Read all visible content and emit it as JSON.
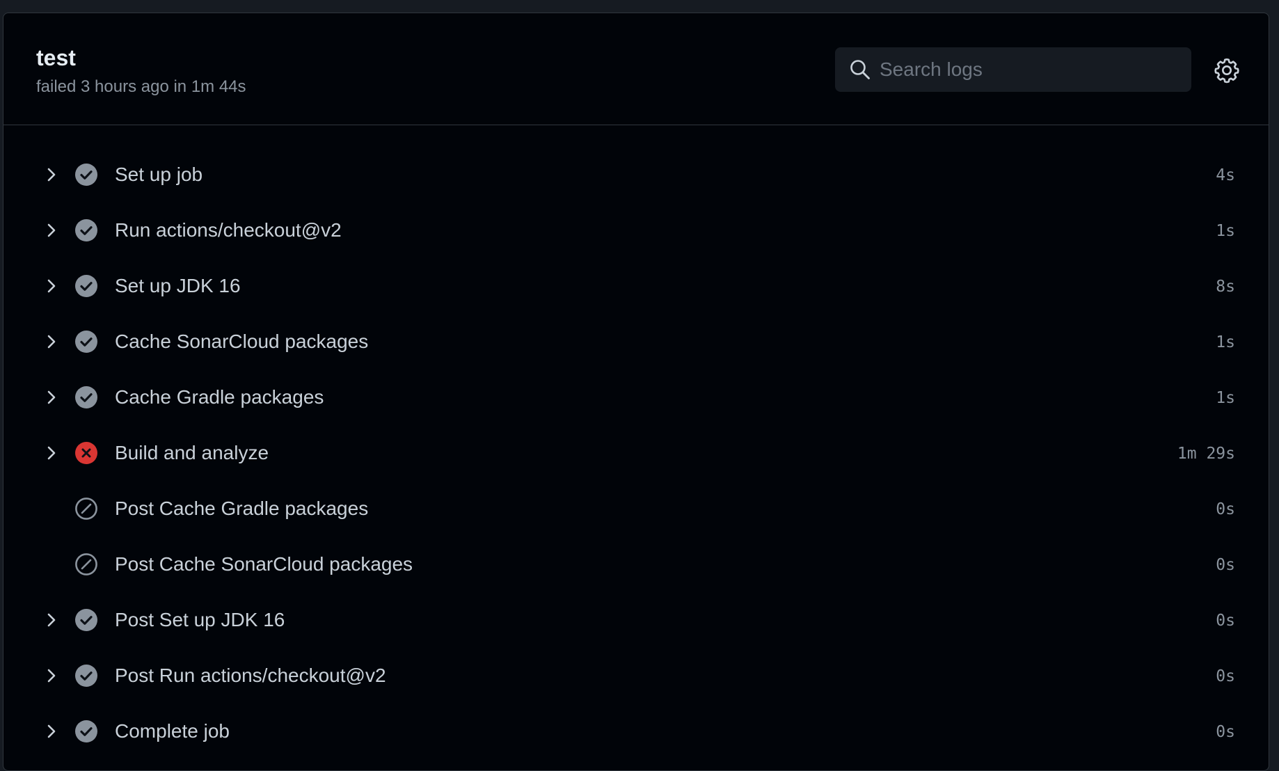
{
  "job": {
    "title": "test",
    "subtitle": "failed 3 hours ago in 1m 44s"
  },
  "search": {
    "placeholder": "Search logs"
  },
  "settings": {
    "icon": "gear-icon"
  },
  "colors": {
    "success": "#8b949e",
    "failure": "#da3633",
    "skipped": "#8b949e"
  },
  "steps": [
    {
      "name": "Set up job",
      "duration": "4s",
      "status": "success",
      "expandable": true
    },
    {
      "name": "Run actions/checkout@v2",
      "duration": "1s",
      "status": "success",
      "expandable": true
    },
    {
      "name": "Set up JDK 16",
      "duration": "8s",
      "status": "success",
      "expandable": true
    },
    {
      "name": "Cache SonarCloud packages",
      "duration": "1s",
      "status": "success",
      "expandable": true
    },
    {
      "name": "Cache Gradle packages",
      "duration": "1s",
      "status": "success",
      "expandable": true
    },
    {
      "name": "Build and analyze",
      "duration": "1m 29s",
      "status": "failure",
      "expandable": true
    },
    {
      "name": "Post Cache Gradle packages",
      "duration": "0s",
      "status": "skipped",
      "expandable": false
    },
    {
      "name": "Post Cache SonarCloud packages",
      "duration": "0s",
      "status": "skipped",
      "expandable": false
    },
    {
      "name": "Post Set up JDK 16",
      "duration": "0s",
      "status": "success",
      "expandable": true
    },
    {
      "name": "Post Run actions/checkout@v2",
      "duration": "0s",
      "status": "success",
      "expandable": true
    },
    {
      "name": "Complete job",
      "duration": "0s",
      "status": "success",
      "expandable": true
    }
  ]
}
